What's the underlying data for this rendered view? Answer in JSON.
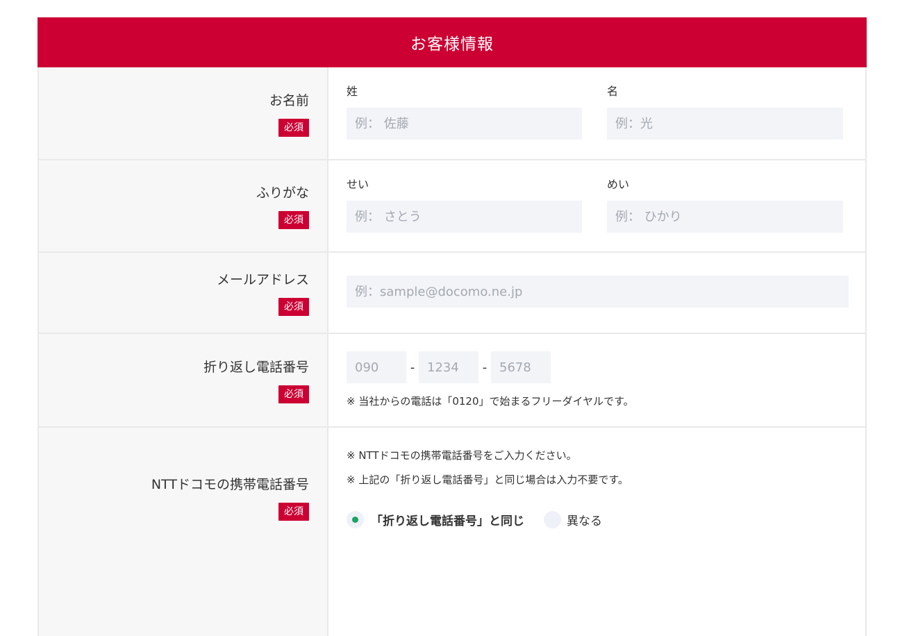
{
  "header": {
    "title": "お客様情報"
  },
  "required_label": "必須",
  "name_row": {
    "label": "お名前",
    "last": {
      "label": "姓",
      "placeholder": "例： 佐藤"
    },
    "first": {
      "label": "名",
      "placeholder": "例：光"
    }
  },
  "furigana_row": {
    "label": "ふりがな",
    "last": {
      "label": "せい",
      "placeholder": "例： さとう"
    },
    "first": {
      "label": "めい",
      "placeholder": "例： ひかり"
    }
  },
  "email_row": {
    "label": "メールアドレス",
    "placeholder": "例：sample@docomo.ne.jp"
  },
  "phone_row": {
    "label": "折り返し電話番号",
    "part1_placeholder": "090",
    "part2_placeholder": "1234",
    "part3_placeholder": "5678",
    "separator": "-",
    "note": "※ 当社からの電話は「0120」で始まるフリーダイヤルです。"
  },
  "docomo_row": {
    "label": "NTTドコモの携帯電話番号",
    "note1": "※ NTTドコモの携帯電話番号をご入力ください。",
    "note2": "※ 上記の「折り返し電話番号」と同じ場合は入力不要です。",
    "option_same": "「折り返し電話番号」と同じ",
    "option_different": "異なる",
    "selected": "same"
  },
  "colors": {
    "brand": "#cc0033",
    "radio_selected": "#19a463",
    "input_bg": "#f2f4f8"
  }
}
